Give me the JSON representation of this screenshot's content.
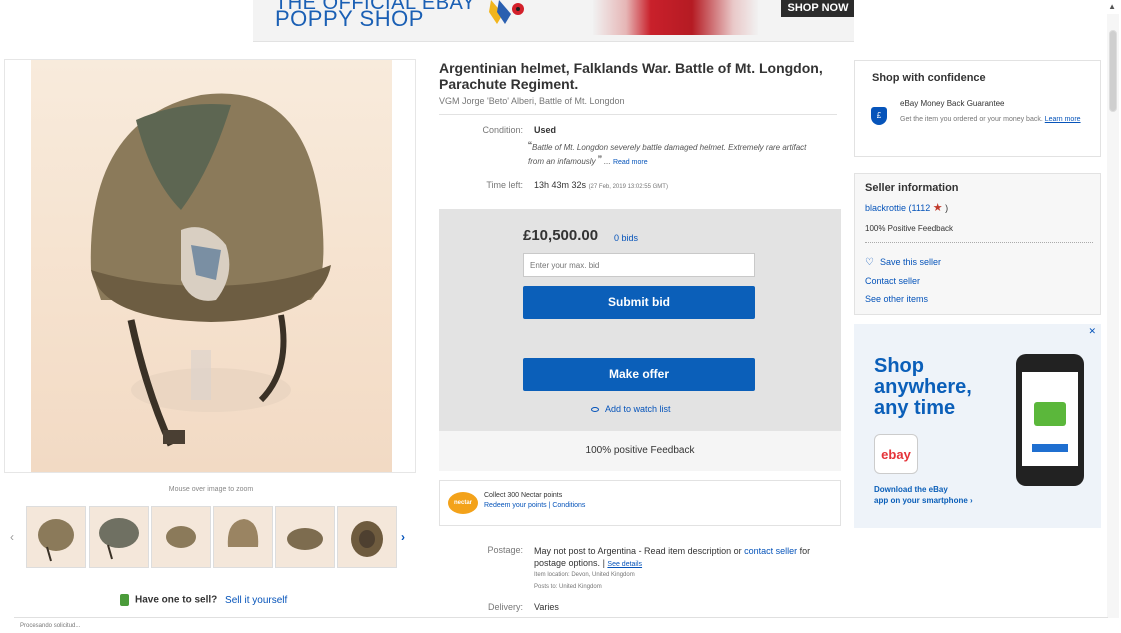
{
  "banner": {
    "line1": "THE OFFICIAL EBAY",
    "line2": "POPPY SHOP",
    "cta": "SHOP NOW"
  },
  "gallery": {
    "zoom_hint": "Mouse over image to zoom",
    "thumbnail_count": 6
  },
  "sell": {
    "prompt": "Have one to sell?",
    "link": "Sell it yourself"
  },
  "listing": {
    "title": "Argentinian helmet, Falklands War. Battle of Mt. Longdon, Parachute Regiment.",
    "subtitle": "VGM Jorge 'Beto' Alberi, Battle of Mt. Longdon",
    "condition_label": "Condition:",
    "condition_value": "Used",
    "condition_note": "Battle of Mt. Longdon severely battle damaged helmet. Extremely rare artifact from an infamously",
    "read_more": "Read more",
    "time_left_label": "Time left:",
    "time_left_value": "13h 43m 32s",
    "end_time": "(27 Feb, 2019  13:02:55 GMT)"
  },
  "bidding": {
    "price": "£10,500.00",
    "bids": "0 bids",
    "input_placeholder": "Enter your max. bid",
    "submit_label": "Submit bid",
    "offer_label": "Make offer",
    "watch_label": "Add to watch list",
    "positive_feedback": "100% positive Feedback"
  },
  "nectar": {
    "logo": "nectar",
    "collect": "Collect 300 Nectar points",
    "links": "Redeem your points | Conditions"
  },
  "postage": {
    "label": "Postage:",
    "text": "May not post to Argentina - Read item description or",
    "contact_link": "contact seller",
    "text2": "for postage options.",
    "details_link": "See details",
    "location": "Item location:  Devon, United Kingdom",
    "posts_to": "Posts to:  United Kingdom",
    "delivery_label": "Delivery:",
    "delivery_value": "Varies"
  },
  "confidence": {
    "title": "Shop with confidence",
    "guarantee": "eBay Money Back Guarantee",
    "guarantee_text": "Get the item you ordered or your money back.",
    "learn_more": "Learn more"
  },
  "seller": {
    "title": "Seller information",
    "username": "blackrottie",
    "feedback_score": "(1112",
    "feedback_close": ")",
    "positive": "100% Positive Feedback",
    "save": "Save this seller",
    "contact": "Contact seller",
    "other_items": "See other items"
  },
  "ad": {
    "headline1": "Shop",
    "headline2": "anywhere,",
    "headline3": "any time",
    "ebay_logo": "ebay",
    "download1": "Download the eBay",
    "download2": "app on your smartphone ›",
    "close": "✕"
  },
  "status_bar": "Procesando solicitud...",
  "colors": {
    "brand_blue": "#0b5fb9",
    "link_blue": "#0654ba",
    "bid_panel": "#e3e3e3"
  }
}
